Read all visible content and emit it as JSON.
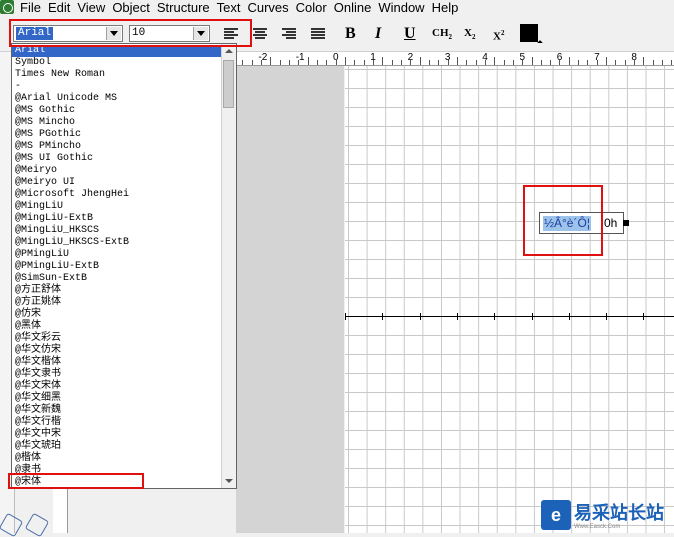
{
  "menu": [
    "File",
    "Edit",
    "View",
    "Object",
    "Structure",
    "Text",
    "Curves",
    "Color",
    "Online",
    "Window",
    "Help"
  ],
  "toolbar": {
    "font_value": "Arial",
    "size_value": "10",
    "bold_label": "B",
    "italic_label": "I",
    "underline_label": "U",
    "chemistry_label": "CH",
    "chemistry_sub": "2",
    "subscript_label": "X",
    "subscript_sub": "2",
    "superscript_label": "X",
    "superscript_sup": "2",
    "color": "#000000"
  },
  "font_list": {
    "items": [
      "Arial",
      "Symbol",
      "Times New Roman",
      "-",
      "@Arial Unicode MS",
      "@MS Gothic",
      "@MS Mincho",
      "@MS PGothic",
      "@MS PMincho",
      "@MS UI Gothic",
      "@Meiryo",
      "@Meiryo UI",
      "@Microsoft JhengHei",
      "@MingLiU",
      "@MingLiU-ExtB",
      "@MingLiU_HKSCS",
      "@MingLiU_HKSCS-ExtB",
      "@PMingLiU",
      "@PMingLiU-ExtB",
      "@SimSun-ExtB",
      "@方正舒体",
      "@方正姚体",
      "@仿宋",
      "@黑体",
      "@华文彩云",
      "@华文仿宋",
      "@华文楷体",
      "@华文隶书",
      "@华文宋体",
      "@华文细黑",
      "@华文新魏",
      "@华文行楷",
      "@华文中宋",
      "@华文琥珀",
      "@楷体",
      "@隶书",
      "@宋体"
    ],
    "highlighted": "Arial",
    "marked": "@宋体"
  },
  "ruler": {
    "labels": [
      "-2",
      "-1",
      "0",
      "1",
      "2",
      "3",
      "4",
      "5",
      "6",
      "7",
      "8"
    ]
  },
  "canvas_text": {
    "selected": "½Â°è´Ô¦",
    "rest": "0h"
  },
  "watermark": {
    "logo": "e",
    "text": "易采站长站",
    "sub": "Www.Easck.Com"
  },
  "accent_colors": {
    "highlight": "#3267c8",
    "red_box": "#e01010",
    "watermark": "#1b62b8"
  }
}
